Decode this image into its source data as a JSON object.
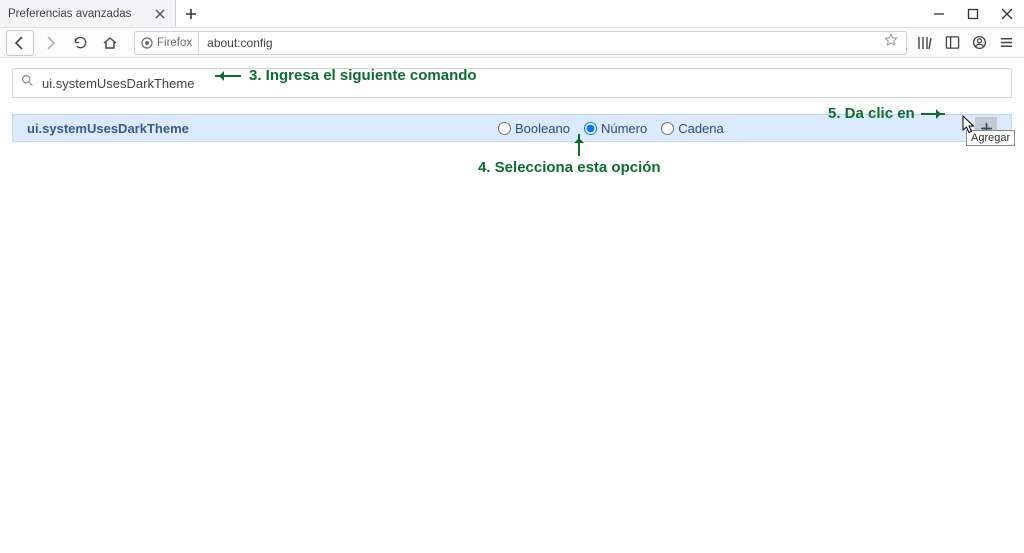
{
  "window": {
    "tab_title": "Preferencias avanzadas",
    "identity_label": "Firefox",
    "url": "about:config"
  },
  "search": {
    "value": "ui.systemUsesDarkTheme"
  },
  "result": {
    "pref_name": "ui.systemUsesDarkTheme",
    "types": {
      "boolean": "Booleano",
      "number": "Número",
      "string": "Cadena",
      "selected": "number"
    },
    "tooltip": "Agregar"
  },
  "annotations": {
    "step3": "3. Ingresa el siguiente comando",
    "step4": "4. Selecciona esta opción",
    "step5": "5. Da clic en"
  }
}
